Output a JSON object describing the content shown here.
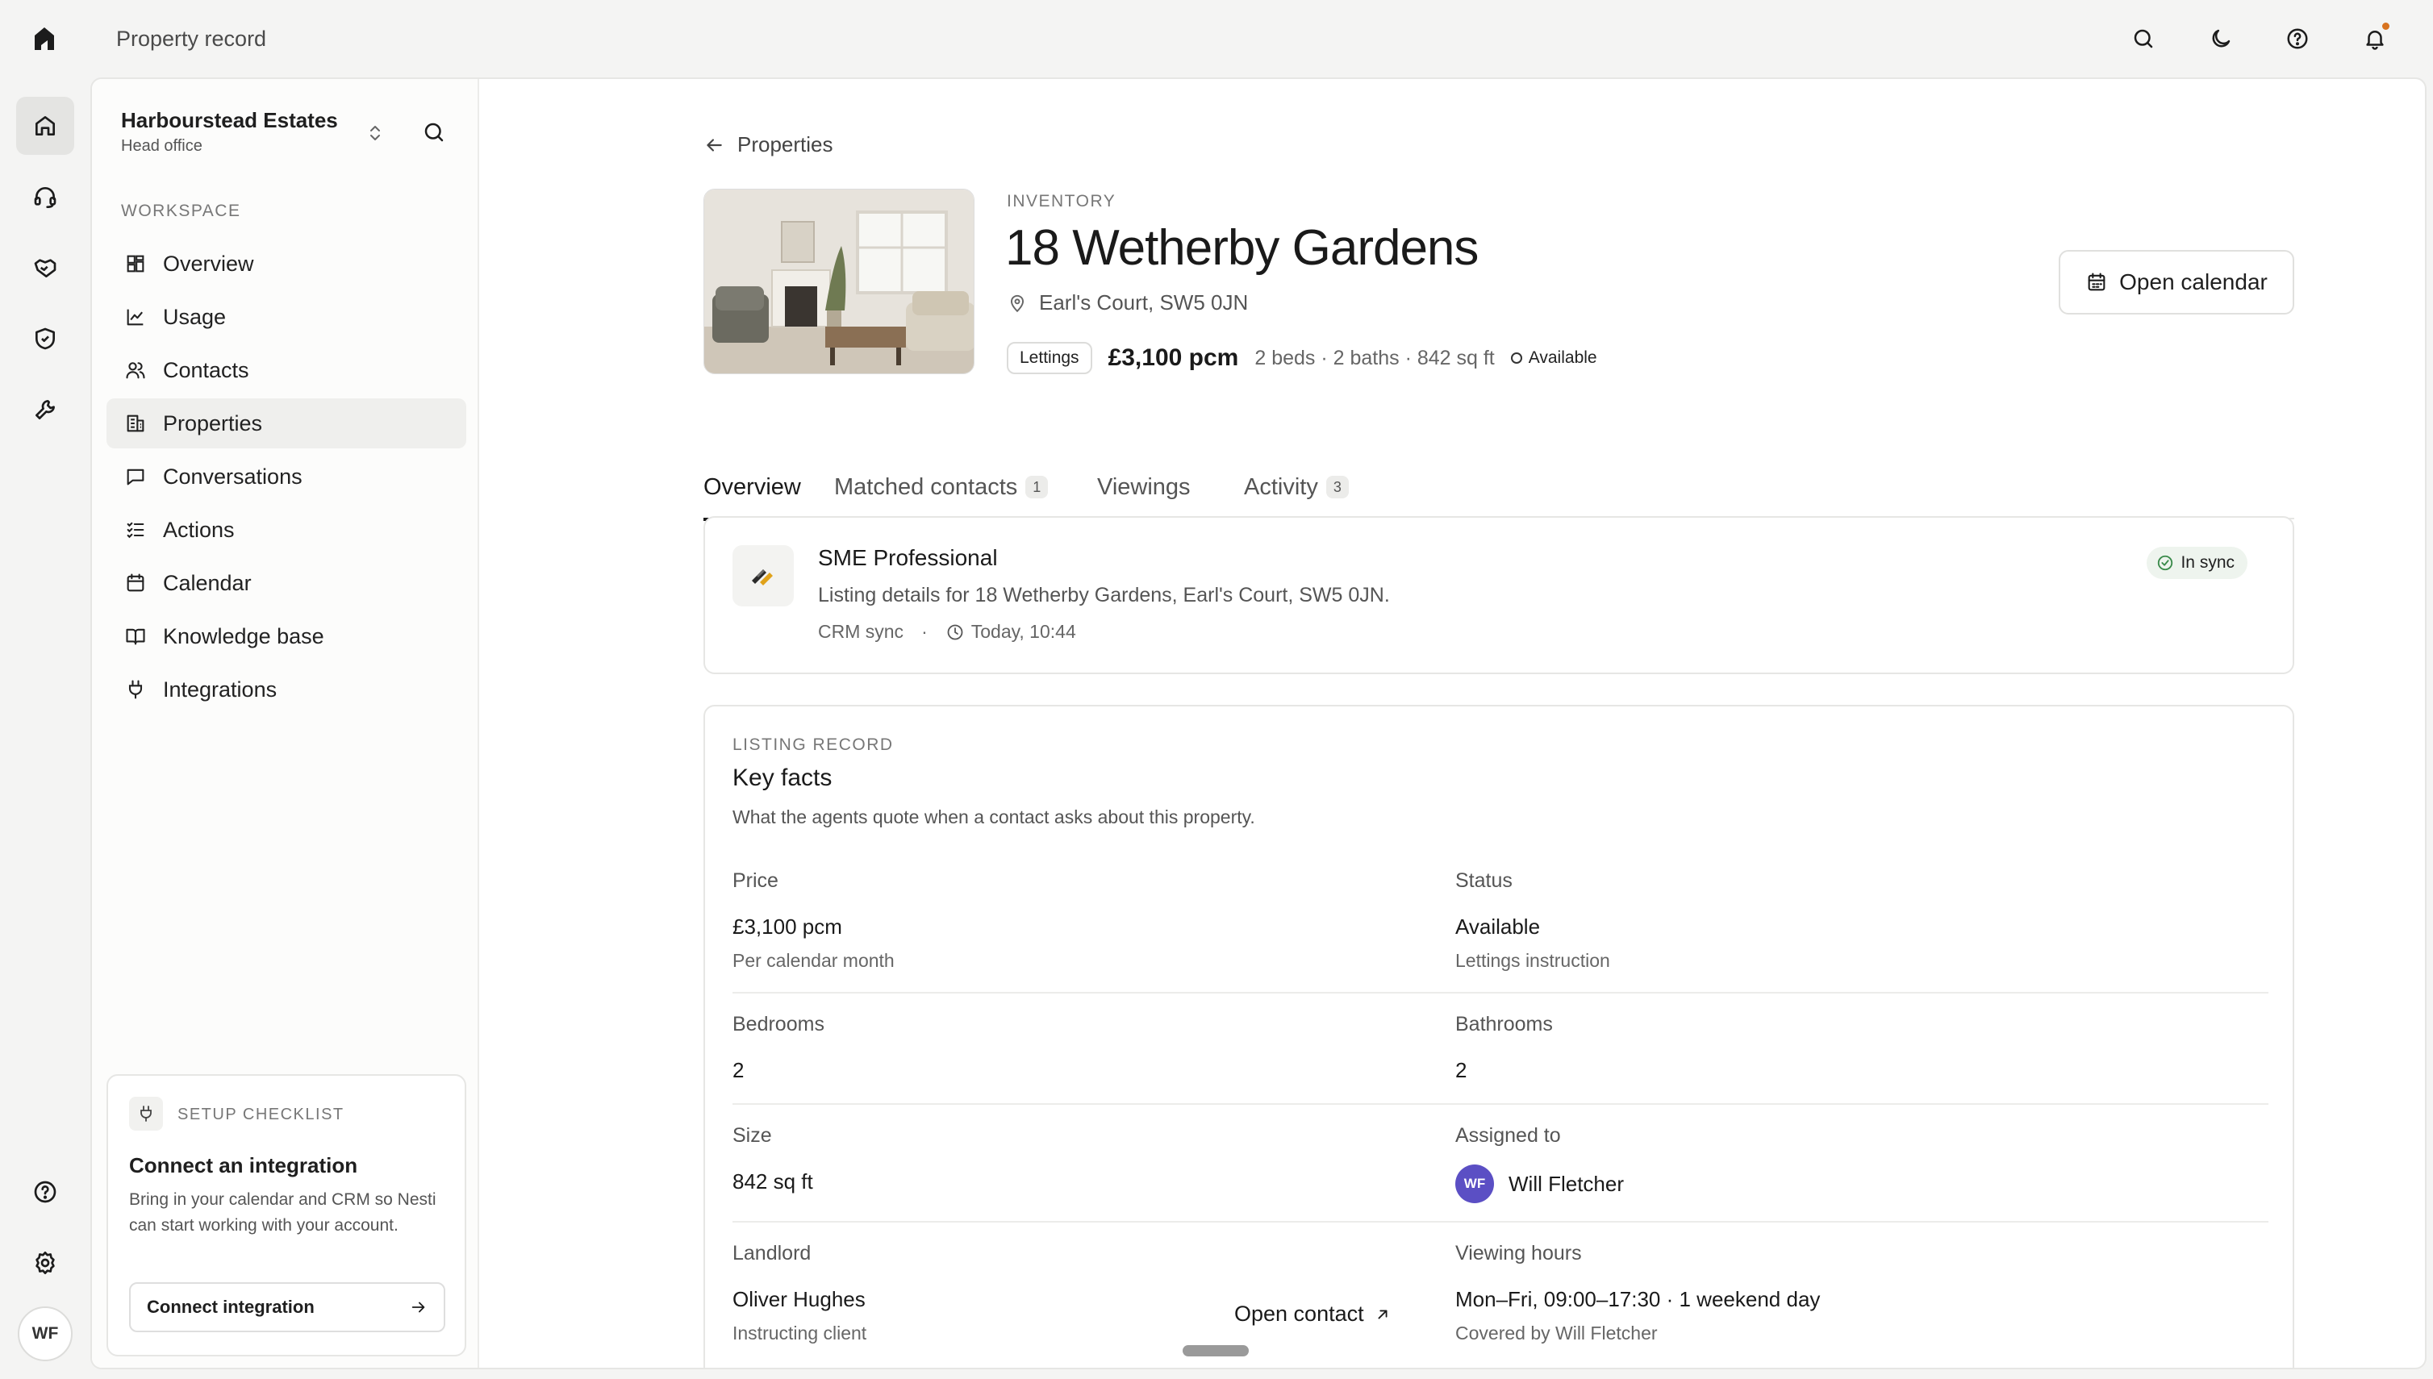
{
  "app": {
    "title": "Property record"
  },
  "org": {
    "name": "Harbourstead Estates",
    "subtitle": "Head office"
  },
  "sidebar": {
    "section_label": "WORKSPACE",
    "items": [
      {
        "label": "Overview",
        "icon": "dashboard-icon"
      },
      {
        "label": "Usage",
        "icon": "chart-line-icon"
      },
      {
        "label": "Contacts",
        "icon": "users-icon"
      },
      {
        "label": "Properties",
        "icon": "building-icon",
        "active": true
      },
      {
        "label": "Conversations",
        "icon": "chat-icon"
      },
      {
        "label": "Actions",
        "icon": "checklist-icon"
      },
      {
        "label": "Calendar",
        "icon": "calendar-icon"
      },
      {
        "label": "Knowledge base",
        "icon": "book-icon"
      },
      {
        "label": "Integrations",
        "icon": "plug-icon"
      }
    ]
  },
  "checklist": {
    "label": "SETUP CHECKLIST",
    "title": "Connect an integration",
    "description": "Bring in your calendar and CRM so Nesti can start working with your account.",
    "button": "Connect integration"
  },
  "user": {
    "initials": "WF"
  },
  "breadcrumb": {
    "back_label": "Properties"
  },
  "property": {
    "category": "INVENTORY",
    "title": "18 Wetherby Gardens",
    "address": "Earl's Court, SW5 0JN",
    "tag": "Lettings",
    "price": "£3,100 pcm",
    "specs": "2 beds · 2 baths · 842 sq ft",
    "status": "Available"
  },
  "actions": {
    "open_calendar": "Open calendar"
  },
  "tabs": [
    {
      "label": "Overview",
      "active": true
    },
    {
      "label": "Matched contacts",
      "count": "1"
    },
    {
      "label": "Viewings"
    },
    {
      "label": "Activity",
      "count": "3"
    }
  ],
  "sync": {
    "provider": "SME Professional",
    "description": "Listing details for 18 Wetherby Gardens, Earl's Court, SW5 0JN.",
    "source": "CRM sync",
    "separator": "·",
    "time": "Today, 10:44",
    "status": "In sync"
  },
  "facts": {
    "label": "LISTING RECORD",
    "title": "Key facts",
    "description": "What the agents quote when a contact asks about this property.",
    "price": {
      "label": "Price",
      "value": "£3,100 pcm",
      "sub": "Per calendar month"
    },
    "status": {
      "label": "Status",
      "value": "Available",
      "sub": "Lettings instruction"
    },
    "bedrooms": {
      "label": "Bedrooms",
      "value": "2"
    },
    "bathrooms": {
      "label": "Bathrooms",
      "value": "2"
    },
    "size": {
      "label": "Size",
      "value": "842 sq ft"
    },
    "assigned": {
      "label": "Assigned to",
      "initials": "WF",
      "name": "Will Fletcher"
    },
    "landlord": {
      "label": "Landlord",
      "value": "Oliver Hughes",
      "sub": "Instructing client",
      "action": "Open contact"
    },
    "viewing": {
      "label": "Viewing hours",
      "value": "Mon–Fri, 09:00–17:30 · 1 weekend day",
      "sub": "Covered by Will Fletcher"
    }
  },
  "colors": {
    "accent": "#5b4fc4",
    "notification": "#d8731f",
    "sync_badge_bg": "#eef4ee",
    "sync_ok": "#3a8a4a"
  }
}
